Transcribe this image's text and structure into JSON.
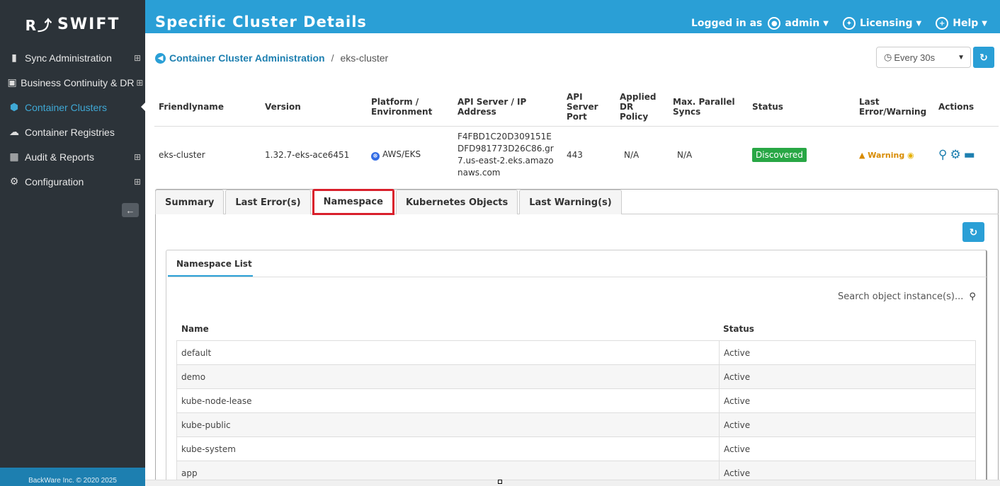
{
  "brand": {
    "mark": "R⤴",
    "name": "SWIFT"
  },
  "sidebar": {
    "items": [
      {
        "icon": "▮",
        "label": "Sync Administration",
        "expand": "⊞"
      },
      {
        "icon": "▣",
        "label": "Business Continuity & DR",
        "expand": "⊞"
      },
      {
        "icon": "⬢",
        "label": "Container Clusters",
        "expand": ""
      },
      {
        "icon": "☁",
        "label": "Container Registries",
        "expand": ""
      },
      {
        "icon": "▦",
        "label": "Audit & Reports",
        "expand": "⊞"
      },
      {
        "icon": "⚙",
        "label": "Configuration",
        "expand": "⊞"
      }
    ],
    "collapse_icon": "←",
    "copyright": "BackWare Inc. © 2020 2025"
  },
  "header": {
    "title": "Specific Cluster Details",
    "logged_in_as": "Logged in as",
    "user": "admin",
    "licensing": "Licensing",
    "help": "Help"
  },
  "breadcrumb": {
    "link": "Container Cluster Administration",
    "separator": "/",
    "current": "eks-cluster"
  },
  "refresh": {
    "interval": "Every 30s"
  },
  "cluster_table": {
    "headers": {
      "friendlyname": "Friendlyname",
      "version": "Version",
      "platform": "Platform / Environment",
      "api_server": "API Server / IP Address",
      "api_port": "API Server Port",
      "dr_policy": "Applied DR Policy",
      "parallel": "Max. Parallel Syncs",
      "status": "Status",
      "last_error": "Last Error/Warning",
      "actions": "Actions"
    },
    "row": {
      "friendlyname": "eks-cluster",
      "version": "1.32.7-eks-ace6451",
      "platform": "AWS/EKS",
      "api_server": "F4FBD1C20D309151EDFD981773D26C86.gr7.us-east-2.eks.amazonaws.com",
      "api_port": "443",
      "dr_policy": "N/A",
      "parallel": "N/A",
      "status": "Discovered",
      "last_error": "Warning"
    }
  },
  "tabs": [
    "Summary",
    "Last Error(s)",
    "Namespace",
    "Kubernetes Objects",
    "Last Warning(s)"
  ],
  "selected_tab": "Namespace",
  "namespace_panel": {
    "tab": "Namespace List",
    "search_placeholder": "Search object instance(s)...",
    "headers": {
      "name": "Name",
      "status": "Status"
    },
    "rows": [
      {
        "name": "default",
        "status": "Active"
      },
      {
        "name": "demo",
        "status": "Active"
      },
      {
        "name": "kube-node-lease",
        "status": "Active"
      },
      {
        "name": "kube-public",
        "status": "Active"
      },
      {
        "name": "kube-system",
        "status": "Active"
      },
      {
        "name": "app",
        "status": "Active"
      }
    ]
  },
  "colors": {
    "header_blue": "#2a9fd6",
    "sidebar_dark": "#2c3339",
    "active_link": "#3fa9d6",
    "discovered_green": "#28a745",
    "selected_tab_outline": "#d9202c"
  }
}
